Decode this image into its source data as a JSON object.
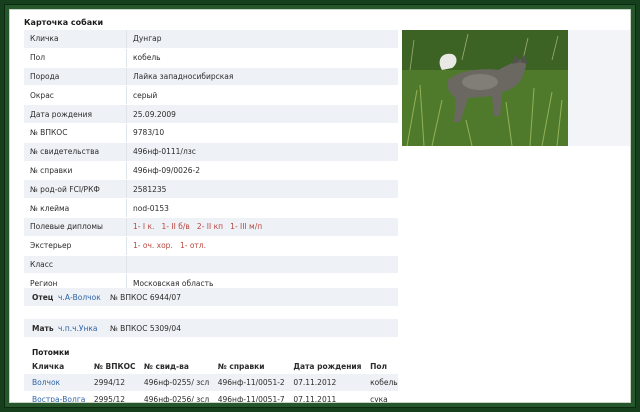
{
  "card": {
    "title": "Карточка собаки",
    "rows": [
      {
        "label": "Кличка",
        "value": "Дунгар"
      },
      {
        "label": "Пол",
        "value": "кобель"
      },
      {
        "label": "Порода",
        "value": "Лайка западносибирская"
      },
      {
        "label": "Окрас",
        "value": "серый"
      },
      {
        "label": "Дата рождения",
        "value": "25.09.2009"
      },
      {
        "label": "№ ВПКОС",
        "value": "9783/10"
      },
      {
        "label": "№ свидетельства",
        "value": "496нф-0111/лзс"
      },
      {
        "label": "№ справки",
        "value": "496нф-09/0026-2"
      },
      {
        "label": "№ род-ой FCI/РКФ",
        "value": "2581235"
      },
      {
        "label": "№ клейма",
        "value": "nod-0153"
      },
      {
        "label": "Полевые дипломы",
        "value": "1- I к.   1- II б/в   2- II кп   1- III м/п"
      },
      {
        "label": "Экстерьер",
        "value": "1- оч. хор.   1- отл."
      },
      {
        "label": "Класс",
        "value": ""
      },
      {
        "label": "Регион",
        "value": "Московская область"
      }
    ]
  },
  "father": {
    "label": "Отец",
    "name": "ч.А-Волчок",
    "reg": "№ ВПКОС 6944/07"
  },
  "mother": {
    "label": "Мать",
    "name": "ч.п.ч.Унка",
    "reg": "№ ВПКОС 5309/04"
  },
  "offspring": {
    "title": "Потомки",
    "headers": [
      "Кличка",
      "№ ВПКОС",
      "№ свид-ва",
      "№ справки",
      "Дата рождения",
      "Пол"
    ],
    "rows": [
      [
        "Волчок",
        "2994/12",
        "496нф-0255/ зсл",
        "496нф-11/0051-2",
        "07.11.2012",
        "кобель"
      ],
      [
        "Востра-Волга",
        "2995/12",
        "496нф-0256/ зсл",
        "496нф-11/0051-7",
        "07.11.2011",
        "сука"
      ]
    ]
  },
  "photo": {
    "subject": "dog-photo"
  },
  "colors": {
    "frame": "#25562c",
    "row_alt": "#eef1f6",
    "link": "#2e63a6",
    "diploma": "#b8463e"
  }
}
